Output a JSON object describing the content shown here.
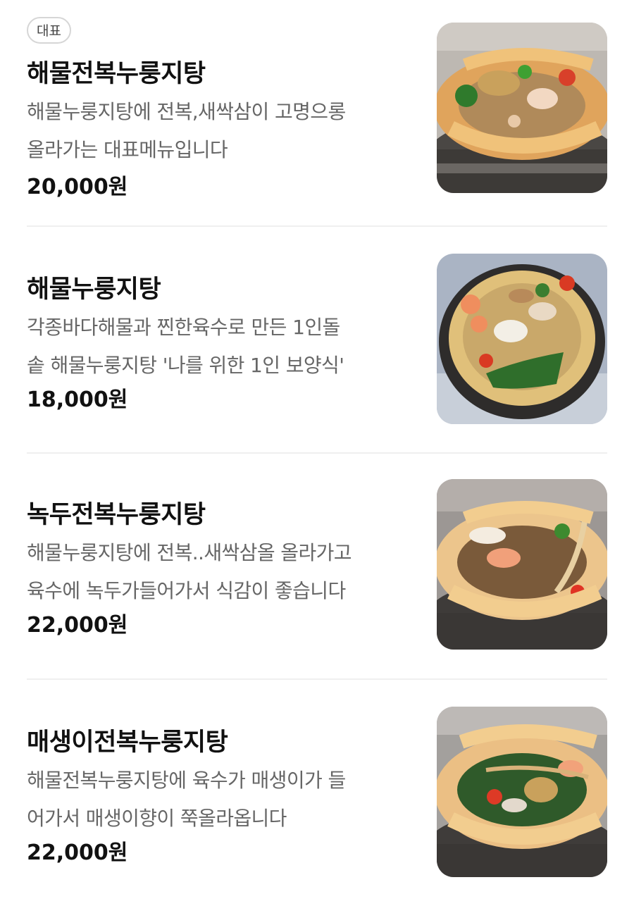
{
  "menu": {
    "items": [
      {
        "badge": "대표",
        "name": "해물전복누룽지탕",
        "desc_line1": "해물누룽지탕에 전복,새싹삼이 고명으롱",
        "desc_line2": "올라가는 대표메뉴입니다",
        "price": "20,000원",
        "image_icon": "food-photo-icon"
      },
      {
        "name": "해물누룽지탕",
        "desc_line1": "각종바다해물과 찐한육수로 만든 1인돌",
        "desc_line2": "솥 해물누룽지탕 '나를 위한 1인 보양식'",
        "price": "18,000원",
        "image_icon": "food-photo-icon"
      },
      {
        "name": "녹두전복누룽지탕",
        "desc_line1": "해물누룽지탕에 전복..새싹삼올 올라가고",
        "desc_line2": "육수에 녹두가들어가서 식감이 좋습니다",
        "price": "22,000원",
        "image_icon": "food-photo-icon"
      },
      {
        "name": "매생이전복누룽지탕",
        "desc_line1": "해물전복누룽지탕에 육수가 매생이가 들",
        "desc_line2": "어가서 매생이향이 쭉올라옵니다",
        "price": "22,000원",
        "image_icon": "food-photo-icon"
      }
    ]
  },
  "colors": {
    "text_primary": "#111111",
    "text_secondary": "#666666",
    "divider": "#efefef",
    "badge_border": "#d6d6d6"
  }
}
